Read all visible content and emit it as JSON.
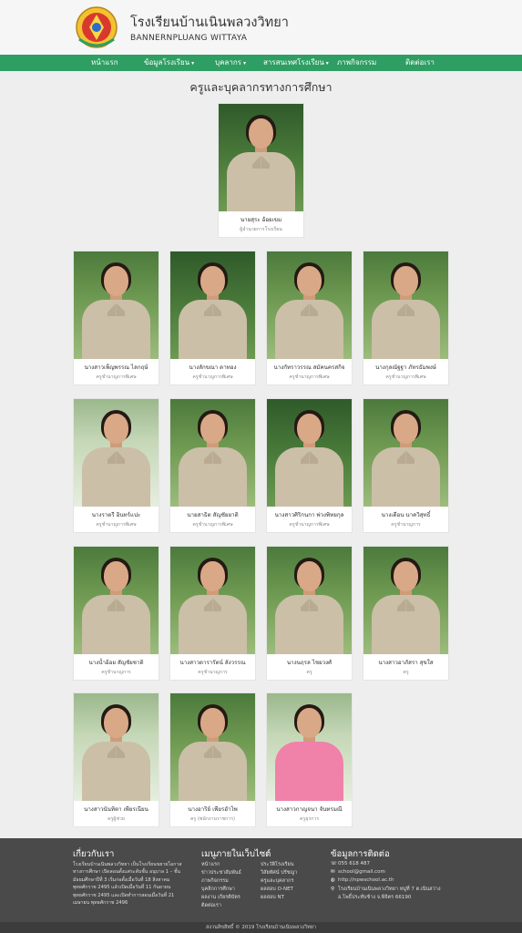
{
  "header": {
    "school_name": "โรงเรียนบ้านเนินพลวงวิทยา",
    "school_name_en": "BANNERNPLUANG WITTAYA"
  },
  "nav": [
    {
      "label": "หน้าแรก",
      "dropdown": false
    },
    {
      "label": "ข้อมูลโรงเรียน",
      "dropdown": true
    },
    {
      "label": "บุคลากร",
      "dropdown": true
    },
    {
      "label": "สารสนเทศโรงเรียน",
      "dropdown": true
    },
    {
      "label": "ภาพกิจกรรม",
      "dropdown": false
    },
    {
      "label": "ติดต่อเรา",
      "dropdown": false
    }
  ],
  "page_title": "ครูและบุคลากรทางการศึกษา",
  "director": {
    "name": "นายสุระ อ้อยเขม",
    "role": "ผู้อำนวยการโรงเรียน"
  },
  "staff": [
    {
      "name": "นางสาวเพ็ญพรรณ ไลกฤษ์",
      "role": "ครูชำนาญการพิเศษ"
    },
    {
      "name": "นางลักขณา ดาทอง",
      "role": "ครูชำนาญการพิเศษ"
    },
    {
      "name": "นางกัทราวรรณ สมัคนครสกิจ",
      "role": "ครูชำนาญการพิเศษ"
    },
    {
      "name": "นางกุลณัฐฐา ภัทรธัมพงษ์",
      "role": "ครูชำนาญการพิเศษ"
    },
    {
      "name": "นางราตรี อินทร์แปะ",
      "role": "ครูชำนาญการพิเศษ"
    },
    {
      "name": "นายสาธิต สัญชัยยาติ",
      "role": "ครูชำนาญการพิเศษ"
    },
    {
      "name": "นางสาวศิริกนกา พ่วงพิทยกุล",
      "role": "ครูชำนาญการพิเศษ"
    },
    {
      "name": "นางเดือน นาควิสุทธิ์",
      "role": "ครูชำนาญการ"
    },
    {
      "name": "นางน้ำอ้อย สัญชัยชาติ",
      "role": "ครูชำนาญการ"
    },
    {
      "name": "นางสาวดารารัตน์ ลังวรรณ",
      "role": "ครูชำนาญการ"
    },
    {
      "name": "นางนฤรล ไชยวงศ์",
      "role": "ครู"
    },
    {
      "name": "นางสาวอาภัสรา สุขใส",
      "role": "ครู"
    },
    {
      "name": "นางสาวนันทิดา เพียรเนียน",
      "role": "ครูผู้ช่วย"
    },
    {
      "name": "นางอาริย์ เพียรอำไพ",
      "role": "ครู (พนักงานราชการ)"
    },
    {
      "name": "นางสาวกาญจนา จันทรมณี",
      "role": "ครูธุรการ"
    }
  ],
  "footer": {
    "about_title": "เกี่ยวกับเรา",
    "about_text": "โรงเรียนบ้านเนินพลวงวิทยา เป็นโรงเรียนขยายโอกาส ทางการศึกษา เปิดสอนตั้งแต่ระดับชั้น อนุบาล 1 – ชั้นมัธยมศึกษาปีที่ 3 เริ่มก่อตั้งเมื่อวันที่ 18 สิงหาคม พุทธศักราช 2495 แล้วเปิดเมื่อวันที่ 11 กันยายน พุทธศักราช 2495 และเปิดทำการสอนเมื่อวันที่ 21 เมษายน พุทธศักราช 2496",
    "menu_title": "เมนูภายในเว็บไซต์",
    "menu_col1": [
      "หน้าแรก",
      "ข่าวประชาสัมพันธ์",
      "ภาพกิจกรรม",
      "บุคลิกการศึกษา",
      "ผลงาน เกียรติบัตร",
      "ติดต่อเรา"
    ],
    "menu_col2": [
      "ประวัติโรงเรียน",
      "วิสัยทัศน์ ปรัชญา",
      "ครูและบุคลากร",
      "ผลสอบ O-NET",
      "ผลสอบ NT"
    ],
    "contact_title": "ข้อมูลการติดต่อ",
    "contact": [
      {
        "icon": "phone-icon",
        "glyph": "☏",
        "text": "055 618 487"
      },
      {
        "icon": "email-icon",
        "glyph": "✉",
        "text": "school@gmail.com"
      },
      {
        "icon": "globe-icon",
        "glyph": "◍",
        "text": "http://npwschool.ac.th"
      },
      {
        "icon": "location-icon",
        "glyph": "⚲",
        "text": "โรงเรียนบ้านเนินพลวงวิทยา หมู่ที่ 7 ต.เนินสว่าง"
      },
      {
        "icon": "",
        "glyph": "",
        "text": "อ.โพธิ์ประทับช้าง จ.พิจิตร 66190"
      }
    ],
    "copyright": "สงวนลิขสิทธิ์ © 2019 โรงเรียนบ้านเนินพลวงวิทยา"
  },
  "colors": {
    "nav_bg": "#2e9e63",
    "footer_bg": "#4a4a4a"
  }
}
